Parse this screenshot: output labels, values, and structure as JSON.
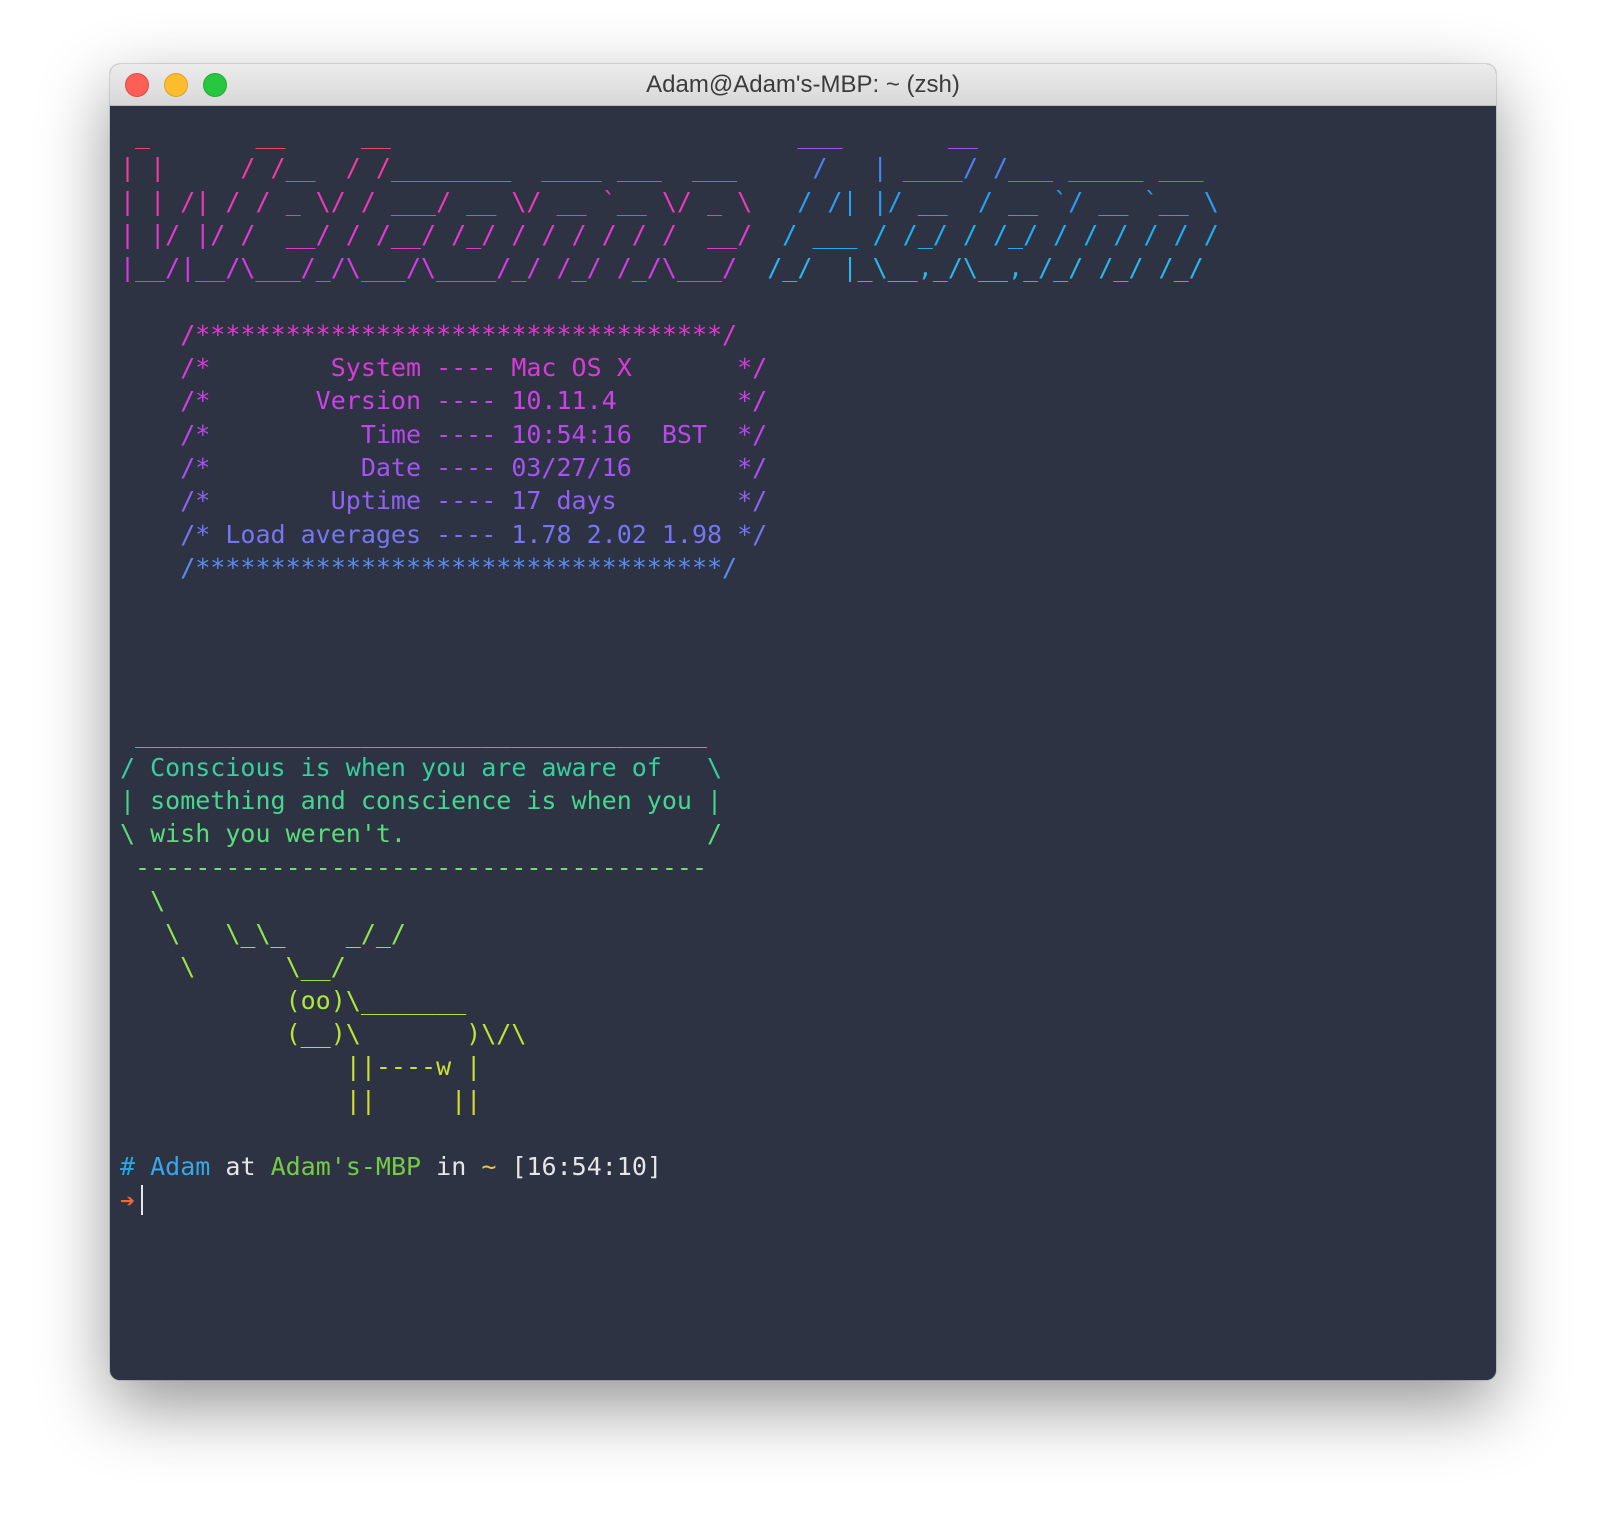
{
  "window": {
    "title": "Adam@Adam's-MBP: ~ (zsh)"
  },
  "colors": {
    "terminal_bg": "#2d3343",
    "prompt_hash": "#2aa7e3",
    "prompt_user": "#36a8e8",
    "prompt_host": "#74cc45",
    "prompt_text": "#e6e6e6",
    "prompt_arrow": "#ef6a3a"
  },
  "banner": {
    "lines": [
      [
        {
          "t": " _       __     __",
          "c": "#f2446c"
        },
        {
          "t": "                           ___       __",
          "c": "#a155f2"
        }
      ],
      [
        {
          "t": "| |     / /__  / /________  ____ ___  ___",
          "c": "#f23d9f"
        },
        {
          "t": "     /   | ____/ /___ _____ ___",
          "c": "#4a82f0"
        }
      ],
      [
        {
          "t": "| | /| / / _ \\/ / ___/ __ \\/ __ `__ \\/ _ \\",
          "c": "#ec3bb9"
        },
        {
          "t": "   / /| |/ __  / __ `/ __ `__ \\",
          "c": "#2b9ef0"
        }
      ],
      [
        {
          "t": "| |/ |/ /  __/ / /__/ /_/ / / / / / /  __/",
          "c": "#e43ad2"
        },
        {
          "t": "  / ___ / /_/ / /_/ / / / / / /",
          "c": "#1fb0f2"
        }
      ],
      [
        {
          "t": "|__/|__/\\___/_/\\___/\\____/_/ /_/ /_/\\___/",
          "c": "#d63be6"
        },
        {
          "t": "  /_/  |_\\__,_/\\__,_/_/ /_/ /_/",
          "c": "#2cb6ec"
        }
      ]
    ]
  },
  "sysinfo": {
    "lines": [
      {
        "t": "    /***********************************/",
        "c": "#e23ad0"
      },
      {
        "t": "    /*        System ---- Mac OS X       */",
        "c": "#d93bd9"
      },
      {
        "t": "    /*       Version ---- 10.11.4        */",
        "c": "#cc42e6"
      },
      {
        "t": "    /*          Time ---- 10:54:16  BST  */",
        "c": "#b948ee"
      },
      {
        "t": "    /*          Date ---- 03/27/16       */",
        "c": "#a653f2"
      },
      {
        "t": "    /*        Uptime ---- 17 days        */",
        "c": "#8f62f2"
      },
      {
        "t": "    /* Load averages ---- 1.78 2.02 1.98 */",
        "c": "#7675f2"
      },
      {
        "t": "    /***********************************/",
        "c": "#5b8bf0"
      }
    ]
  },
  "fortune": {
    "lines": [
      {
        "t": " ______________________________________",
        "c": "#29c7b0"
      },
      {
        "t": "/ Conscious is when you are aware of   \\",
        "c": "#35cfa0"
      },
      {
        "t": "| something and conscience is when you |",
        "c": "#46d690"
      },
      {
        "t": "\\ wish you weren't.                    /",
        "c": "#5bdc7a"
      },
      {
        "t": " --------------------------------------",
        "c": "#6fe068"
      },
      {
        "t": "  \\",
        "c": "#7fe35c"
      },
      {
        "t": "   \\   \\_\\_    _/_/",
        "c": "#8fe54f"
      },
      {
        "t": "    \\      \\__/",
        "c": "#9fe645"
      },
      {
        "t": "           (oo)\\_______",
        "c": "#aee63d"
      },
      {
        "t": "           (__)\\       )\\/\\",
        "c": "#bce536"
      },
      {
        "t": "               ||----w |",
        "c": "#c8e330"
      },
      {
        "t": "               ||     ||",
        "c": "#d2e02c"
      }
    ]
  },
  "prompt": {
    "hash": "#",
    "user": "Adam",
    "at": "at",
    "host": "Adam's-MBP",
    "in": "in",
    "dir": "~",
    "time": "[16:54:10]",
    "arrow": "➔"
  }
}
